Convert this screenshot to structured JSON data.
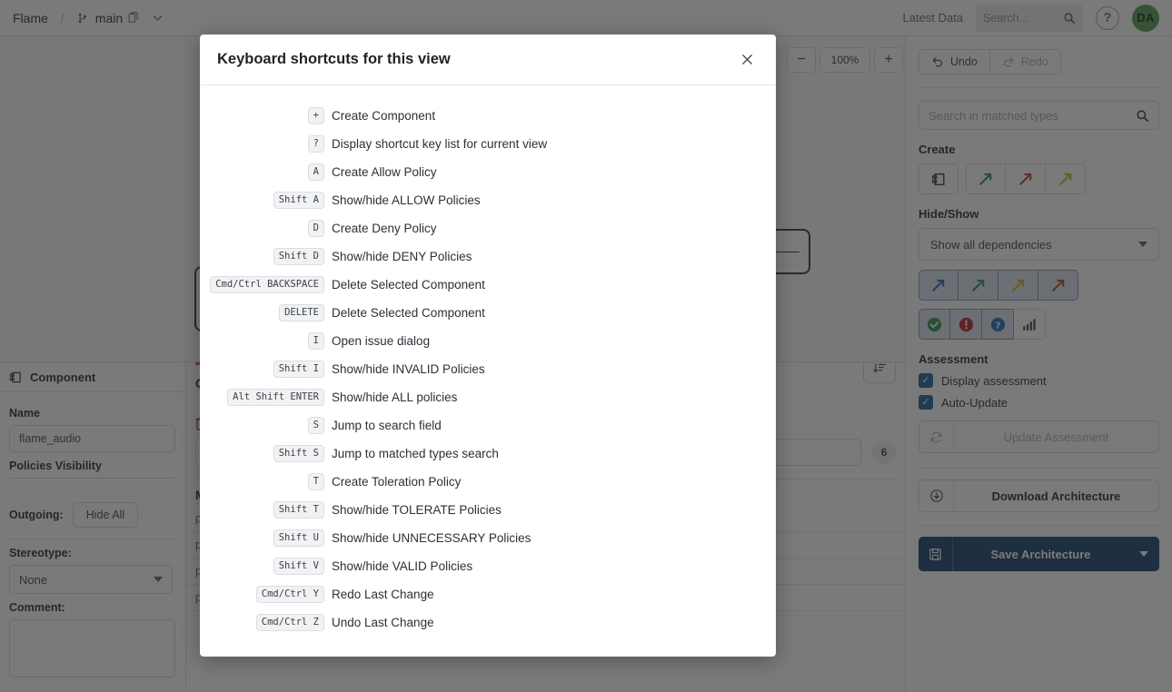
{
  "topbar": {
    "brand": "Flame",
    "separator": "/",
    "branch": "main",
    "branch_icon": "git-branch-icon",
    "copy_icon": "copy-icon",
    "chevron_icon": "chevron-down-icon",
    "latest_data": "Latest Data",
    "search_placeholder": "Search...",
    "help_label": "?",
    "avatar_initials": "DA"
  },
  "canvas": {
    "zoom_out": "−",
    "zoom_level": "100%",
    "zoom_in": "+"
  },
  "component_panel": {
    "header": "Component",
    "name_label": "Name",
    "name_value": "flame_audio",
    "policies_visibility_label": "Policies Visibility",
    "outgoing_label": "Outgoing:",
    "hide_all_label": "Hide All",
    "stereotype_label": "Stereotype:",
    "stereotype_value": "None",
    "comment_label": "Comment:",
    "comment_value": ""
  },
  "mid_panel": {
    "section_title": "C",
    "sub_title": "M",
    "count": "6",
    "links": [
      "p",
      "p",
      "p",
      "packages/flame_audio/lib/flame_audio.dart"
    ]
  },
  "sidebar": {
    "undo_label": "Undo",
    "redo_label": "Redo",
    "search_placeholder": "Search in matched types",
    "create_label": "Create",
    "create_buttons": [
      "create-component-icon",
      "create-allow-policy-icon",
      "create-deny-policy-icon",
      "create-toleration-policy-icon"
    ],
    "hide_show_label": "Hide/Show",
    "dependency_filter_value": "Show all dependencies",
    "arrow_toggles": [
      "dependency-arrow-blue-icon",
      "dependency-arrow-green-icon",
      "dependency-arrow-yellow-icon",
      "dependency-arrow-red-icon"
    ],
    "status_toggles": [
      "valid-status-icon",
      "invalid-status-icon",
      "unknown-status-icon",
      "metrics-icon"
    ],
    "assessment_label": "Assessment",
    "display_assessment_label": "Display assessment",
    "auto_update_label": "Auto-Update",
    "update_assessment_label": "Update Assessment",
    "download_label": "Download Architecture",
    "save_label": "Save Architecture"
  },
  "modal": {
    "title": "Keyboard shortcuts for this view",
    "close_icon": "close-icon",
    "shortcuts": [
      {
        "key": "+",
        "desc": "Create Component"
      },
      {
        "key": "?",
        "desc": "Display shortcut key list for current view"
      },
      {
        "key": "A",
        "desc": "Create Allow Policy"
      },
      {
        "key": "Shift A",
        "desc": "Show/hide ALLOW Policies"
      },
      {
        "key": "D",
        "desc": "Create Deny Policy"
      },
      {
        "key": "Shift D",
        "desc": "Show/hide DENY Policies"
      },
      {
        "key": "Cmd/Ctrl BACKSPACE",
        "desc": "Delete Selected Component"
      },
      {
        "key": "DELETE",
        "desc": "Delete Selected Component"
      },
      {
        "key": "I",
        "desc": "Open issue dialog"
      },
      {
        "key": "Shift I",
        "desc": "Show/hide INVALID Policies"
      },
      {
        "key": "Alt Shift ENTER",
        "desc": "Show/hide ALL policies"
      },
      {
        "key": "S",
        "desc": "Jump to search field"
      },
      {
        "key": "Shift S",
        "desc": "Jump to matched types search"
      },
      {
        "key": "T",
        "desc": "Create Toleration Policy"
      },
      {
        "key": "Shift T",
        "desc": "Show/hide TOLERATE Policies"
      },
      {
        "key": "Shift U",
        "desc": "Show/hide UNNECESSARY Policies"
      },
      {
        "key": "Shift V",
        "desc": "Show/hide VALID Policies"
      },
      {
        "key": "Cmd/Ctrl Y",
        "desc": "Redo Last Change"
      },
      {
        "key": "Cmd/Ctrl Z",
        "desc": "Undo Last Change"
      }
    ]
  },
  "colors": {
    "accent_blue": "#0d3c66",
    "checkbox_blue": "#1a5d96",
    "avatar_green": "#4c9a4c",
    "tab_orange": "#d4521f",
    "link_blue": "#3563a8"
  }
}
